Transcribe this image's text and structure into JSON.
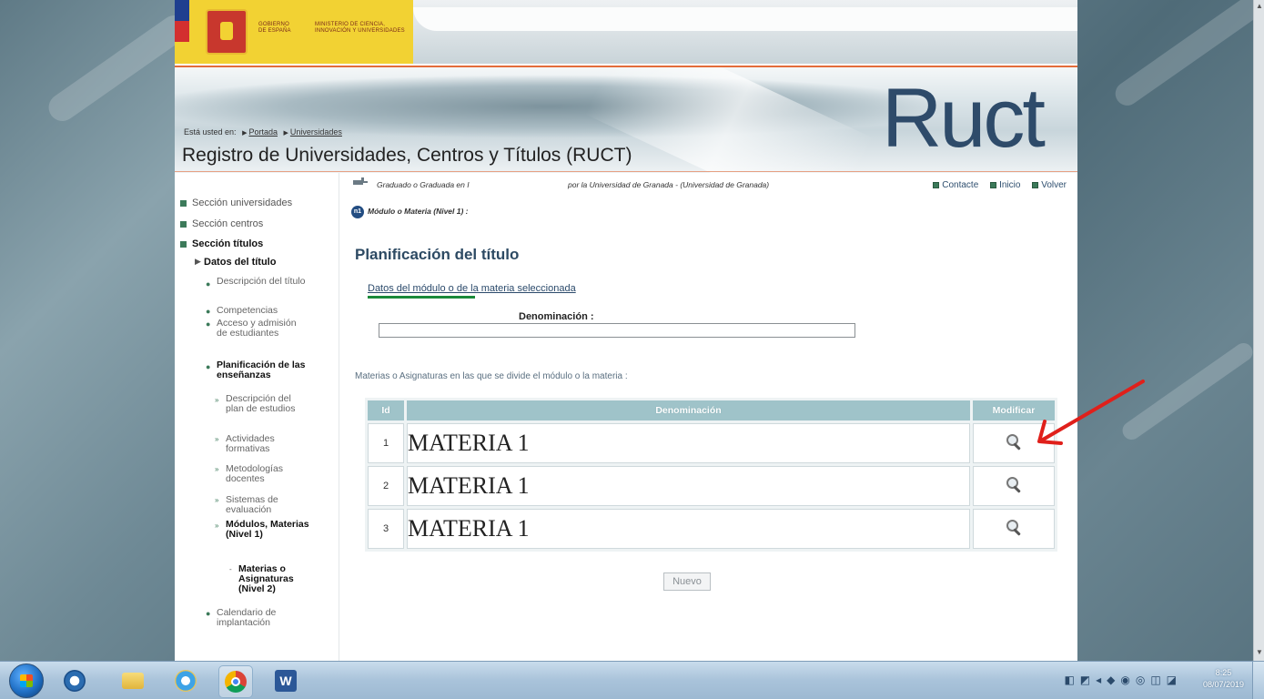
{
  "gov": {
    "gobierno": "GOBIERNO DE ESPAÑA",
    "ministerio": "MINISTERIO DE CIENCIA, INNOVACIÓN Y UNIVERSIDADES"
  },
  "banner": {
    "logo": "Ruct",
    "breadcrumb_prefix": "Está usted en:",
    "breadcrumb": [
      "Portada",
      "Universidades"
    ],
    "site_title": "Registro de Universidades, Centros y Títulos (RUCT)"
  },
  "sidebar": {
    "sections": [
      "Sección universidades",
      "Sección centros",
      "Sección títulos"
    ],
    "datos_titulo": "Datos del título",
    "items": [
      "Descripción del título",
      "Competencias",
      "Acceso y admisión de estudiantes",
      "Planificación de las enseñanzas",
      "Calendario de implantación"
    ],
    "subitems": [
      "Descripción del plan de estudios",
      "Actividades formativas",
      "Metodologías docentes",
      "Sistemas de evaluación",
      "Módulos, Materias (Nivel 1)"
    ],
    "subsub": "Materias o Asignaturas (Nivel 2)"
  },
  "main": {
    "crumb_left": "Graduado o Graduada en I",
    "crumb_right": "por la Universidad de Granada - (Universidad de Granada)",
    "crumb_level_badge": "n1",
    "crumb_level": "Módulo o Materia (Nivel 1) :",
    "links": [
      "Contacte",
      "Inicio",
      "Volver"
    ],
    "section_title": "Planificación del título",
    "data_link": "Datos del módulo o de la materia seleccionada",
    "denom_label": "Denominación :",
    "denom_value": "",
    "materias_text": "Materias o Asignaturas en las que se divide el módulo o la materia :",
    "table": {
      "headers": [
        "Id",
        "Denominación",
        "Modificar"
      ],
      "rows": [
        {
          "id": "1",
          "name": "MATERIA 1"
        },
        {
          "id": "2",
          "name": "MATERIA 1"
        },
        {
          "id": "3",
          "name": "MATERIA 1"
        }
      ]
    },
    "nuevo": "Nuevo"
  },
  "taskbar": {
    "time": "8:25",
    "date": "08/07/2019"
  },
  "colors": {
    "accent": "#2d4a63",
    "header_cell": "#9fc3c9",
    "annotation_arrow": "#e0201b",
    "annotation_underline": "#1a8a3a"
  }
}
